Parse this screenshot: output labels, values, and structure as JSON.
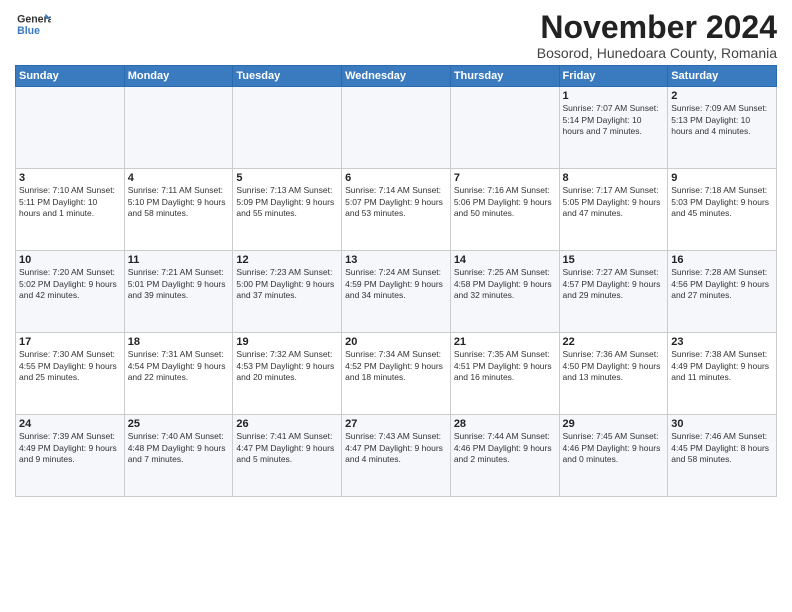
{
  "logo": {
    "line1": "General",
    "line2": "Blue"
  },
  "title": "November 2024",
  "subtitle": "Bosorod, Hunedoara County, Romania",
  "days_header": [
    "Sunday",
    "Monday",
    "Tuesday",
    "Wednesday",
    "Thursday",
    "Friday",
    "Saturday"
  ],
  "weeks": [
    [
      {
        "num": "",
        "info": ""
      },
      {
        "num": "",
        "info": ""
      },
      {
        "num": "",
        "info": ""
      },
      {
        "num": "",
        "info": ""
      },
      {
        "num": "",
        "info": ""
      },
      {
        "num": "1",
        "info": "Sunrise: 7:07 AM\nSunset: 5:14 PM\nDaylight: 10 hours\nand 7 minutes."
      },
      {
        "num": "2",
        "info": "Sunrise: 7:09 AM\nSunset: 5:13 PM\nDaylight: 10 hours\nand 4 minutes."
      }
    ],
    [
      {
        "num": "3",
        "info": "Sunrise: 7:10 AM\nSunset: 5:11 PM\nDaylight: 10 hours\nand 1 minute."
      },
      {
        "num": "4",
        "info": "Sunrise: 7:11 AM\nSunset: 5:10 PM\nDaylight: 9 hours\nand 58 minutes."
      },
      {
        "num": "5",
        "info": "Sunrise: 7:13 AM\nSunset: 5:09 PM\nDaylight: 9 hours\nand 55 minutes."
      },
      {
        "num": "6",
        "info": "Sunrise: 7:14 AM\nSunset: 5:07 PM\nDaylight: 9 hours\nand 53 minutes."
      },
      {
        "num": "7",
        "info": "Sunrise: 7:16 AM\nSunset: 5:06 PM\nDaylight: 9 hours\nand 50 minutes."
      },
      {
        "num": "8",
        "info": "Sunrise: 7:17 AM\nSunset: 5:05 PM\nDaylight: 9 hours\nand 47 minutes."
      },
      {
        "num": "9",
        "info": "Sunrise: 7:18 AM\nSunset: 5:03 PM\nDaylight: 9 hours\nand 45 minutes."
      }
    ],
    [
      {
        "num": "10",
        "info": "Sunrise: 7:20 AM\nSunset: 5:02 PM\nDaylight: 9 hours\nand 42 minutes."
      },
      {
        "num": "11",
        "info": "Sunrise: 7:21 AM\nSunset: 5:01 PM\nDaylight: 9 hours\nand 39 minutes."
      },
      {
        "num": "12",
        "info": "Sunrise: 7:23 AM\nSunset: 5:00 PM\nDaylight: 9 hours\nand 37 minutes."
      },
      {
        "num": "13",
        "info": "Sunrise: 7:24 AM\nSunset: 4:59 PM\nDaylight: 9 hours\nand 34 minutes."
      },
      {
        "num": "14",
        "info": "Sunrise: 7:25 AM\nSunset: 4:58 PM\nDaylight: 9 hours\nand 32 minutes."
      },
      {
        "num": "15",
        "info": "Sunrise: 7:27 AM\nSunset: 4:57 PM\nDaylight: 9 hours\nand 29 minutes."
      },
      {
        "num": "16",
        "info": "Sunrise: 7:28 AM\nSunset: 4:56 PM\nDaylight: 9 hours\nand 27 minutes."
      }
    ],
    [
      {
        "num": "17",
        "info": "Sunrise: 7:30 AM\nSunset: 4:55 PM\nDaylight: 9 hours\nand 25 minutes."
      },
      {
        "num": "18",
        "info": "Sunrise: 7:31 AM\nSunset: 4:54 PM\nDaylight: 9 hours\nand 22 minutes."
      },
      {
        "num": "19",
        "info": "Sunrise: 7:32 AM\nSunset: 4:53 PM\nDaylight: 9 hours\nand 20 minutes."
      },
      {
        "num": "20",
        "info": "Sunrise: 7:34 AM\nSunset: 4:52 PM\nDaylight: 9 hours\nand 18 minutes."
      },
      {
        "num": "21",
        "info": "Sunrise: 7:35 AM\nSunset: 4:51 PM\nDaylight: 9 hours\nand 16 minutes."
      },
      {
        "num": "22",
        "info": "Sunrise: 7:36 AM\nSunset: 4:50 PM\nDaylight: 9 hours\nand 13 minutes."
      },
      {
        "num": "23",
        "info": "Sunrise: 7:38 AM\nSunset: 4:49 PM\nDaylight: 9 hours\nand 11 minutes."
      }
    ],
    [
      {
        "num": "24",
        "info": "Sunrise: 7:39 AM\nSunset: 4:49 PM\nDaylight: 9 hours\nand 9 minutes."
      },
      {
        "num": "25",
        "info": "Sunrise: 7:40 AM\nSunset: 4:48 PM\nDaylight: 9 hours\nand 7 minutes."
      },
      {
        "num": "26",
        "info": "Sunrise: 7:41 AM\nSunset: 4:47 PM\nDaylight: 9 hours\nand 5 minutes."
      },
      {
        "num": "27",
        "info": "Sunrise: 7:43 AM\nSunset: 4:47 PM\nDaylight: 9 hours\nand 4 minutes."
      },
      {
        "num": "28",
        "info": "Sunrise: 7:44 AM\nSunset: 4:46 PM\nDaylight: 9 hours\nand 2 minutes."
      },
      {
        "num": "29",
        "info": "Sunrise: 7:45 AM\nSunset: 4:46 PM\nDaylight: 9 hours\nand 0 minutes."
      },
      {
        "num": "30",
        "info": "Sunrise: 7:46 AM\nSunset: 4:45 PM\nDaylight: 8 hours\nand 58 minutes."
      }
    ]
  ]
}
